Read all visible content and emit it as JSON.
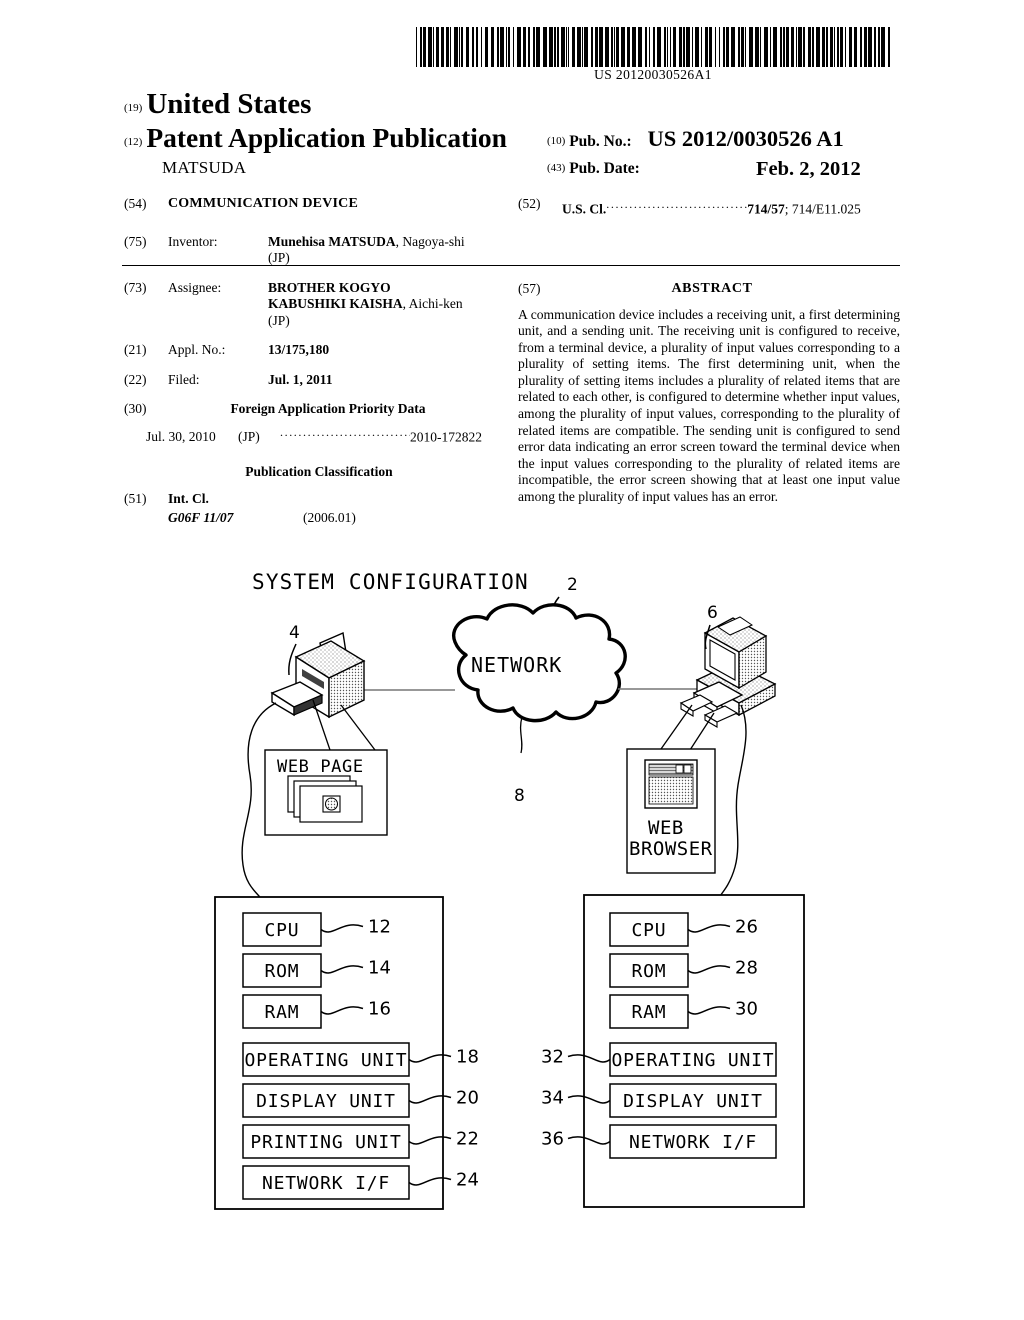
{
  "barcode": {
    "number": "US 20120030526A1"
  },
  "header": {
    "code19": "(19)",
    "country": "United States",
    "code12": "(12)",
    "doc_type": "Patent Application Publication",
    "author": "MATSUDA",
    "pubno_code": "(10)",
    "pubno_label": "Pub. No.:",
    "pubno_value": "US 2012/0030526 A1",
    "pubdate_code": "(43)",
    "pubdate_label": "Pub. Date:",
    "pubdate_value": "Feb. 2, 2012"
  },
  "left_column": {
    "title": {
      "code": "(54)",
      "value": "COMMUNICATION DEVICE"
    },
    "inventor": {
      "code": "(75)",
      "label": "Inventor:",
      "name": "Munehisa MATSUDA",
      "rest": ", Nagoya-shi",
      "line2": "(JP)"
    },
    "assignee": {
      "code": "(73)",
      "label": "Assignee:",
      "line1": "BROTHER KOGYO",
      "line2": "KABUSHIKI KAISHA",
      "line2_rest": ", Aichi-ken",
      "line3": "(JP)"
    },
    "appl_no": {
      "code": "(21)",
      "label": "Appl. No.:",
      "value": "13/175,180"
    },
    "filed": {
      "code": "(22)",
      "label": "Filed:",
      "value": "Jul. 1, 2011"
    },
    "foreign_priority": {
      "code": "(30)",
      "heading": "Foreign Application Priority Data",
      "date": "Jul. 30, 2010",
      "country": "(JP)",
      "dots": "..................................",
      "number": "2010-172822"
    },
    "pub_classification_heading": "Publication Classification",
    "int_cl": {
      "code": "(51)",
      "label": "Int. Cl.",
      "classification": "G06F 11/07",
      "version": "(2006.01)"
    }
  },
  "right_column": {
    "us_cl": {
      "code": "(52)",
      "label": "U.S. Cl.",
      "dots": "...................................",
      "value1": "714/57",
      "value2": "; 714/E11.025"
    },
    "abstract": {
      "code": "(57)",
      "heading": "ABSTRACT",
      "text": "A communication device includes a receiving unit, a first determining unit, and a sending unit. The receiving unit is configured to receive, from a terminal device, a plurality of input values corresponding to a plurality of setting items. The first determining unit, when the plurality of setting items includes a plurality of related items that are related to each other, is configured to determine whether input values, among the plurality of input values, corresponding to the plurality of related items are compatible. The sending unit is configured to send error data indicating an error screen toward the terminal device when the input values corresponding to the plurality of related items are incompatible, the error screen showing that at least one input value among the plurality of input values has an error."
    }
  },
  "figure": {
    "title": "SYSTEM CONFIGURATION",
    "system_ref": "2",
    "network_label": "NETWORK",
    "network_ref": "8",
    "printer_ref": "4",
    "pc_ref": "6",
    "web_page_label": "WEB PAGE",
    "web_browser_label_line1": "WEB",
    "web_browser_label_line2": "BROWSER",
    "device_left": {
      "components": [
        {
          "label": "CPU",
          "ref": "12",
          "wide": false
        },
        {
          "label": "ROM",
          "ref": "14",
          "wide": false
        },
        {
          "label": "RAM",
          "ref": "16",
          "wide": false
        },
        {
          "label": "OPERATING UNIT",
          "ref": "18",
          "wide": true
        },
        {
          "label": "DISPLAY UNIT",
          "ref": "20",
          "wide": true
        },
        {
          "label": "PRINTING UNIT",
          "ref": "22",
          "wide": true
        },
        {
          "label": "NETWORK I/F",
          "ref": "24",
          "wide": true
        }
      ]
    },
    "device_right": {
      "components": [
        {
          "label": "CPU",
          "ref": "26",
          "wide": false,
          "ref_side": "right"
        },
        {
          "label": "ROM",
          "ref": "28",
          "wide": false,
          "ref_side": "right"
        },
        {
          "label": "RAM",
          "ref": "30",
          "wide": false,
          "ref_side": "right"
        },
        {
          "label": "OPERATING UNIT",
          "ref": "32",
          "wide": true,
          "ref_side": "left"
        },
        {
          "label": "DISPLAY UNIT",
          "ref": "34",
          "wide": true,
          "ref_side": "left"
        },
        {
          "label": "NETWORK I/F",
          "ref": "36",
          "wide": true,
          "ref_side": "left"
        }
      ]
    }
  }
}
